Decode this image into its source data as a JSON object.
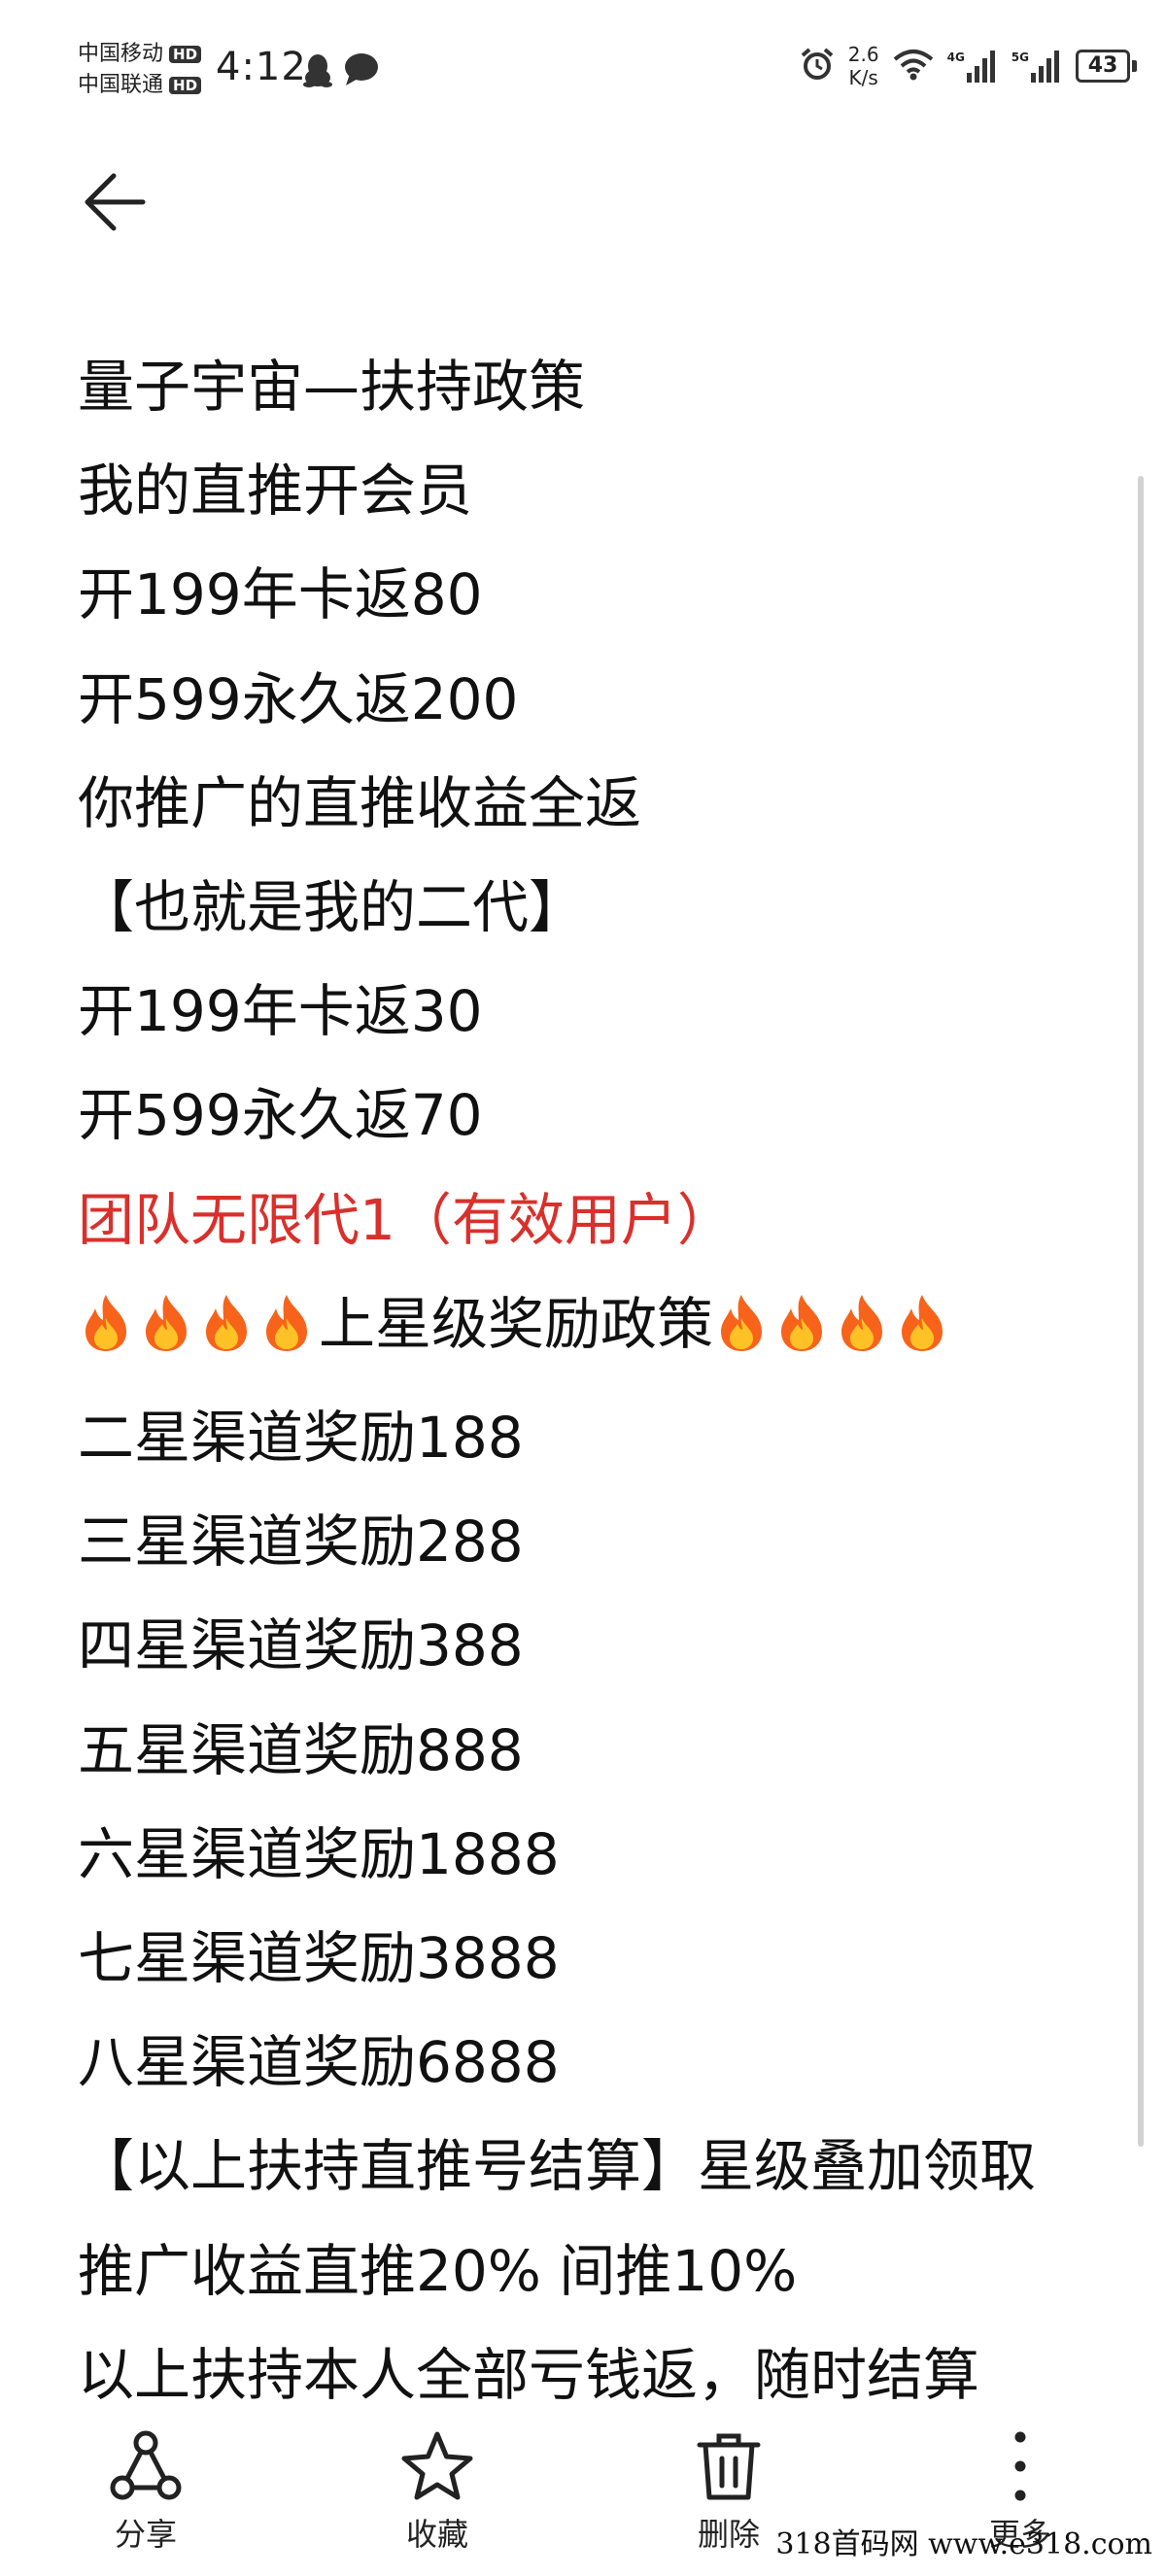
{
  "status_bar": {
    "carrier1": "中国移动",
    "carrier2": "中国联通",
    "hd_label": "HD",
    "time": "4:12",
    "net_speed_value": "2.6",
    "net_speed_unit": "K/s",
    "signal1_tag": "4G",
    "signal2_tag": "5G",
    "battery_level": "43",
    "icons": [
      "qq-penguin-icon",
      "chat-bubble-icon",
      "alarm-clock-icon",
      "wifi-icon",
      "signal-bars-icon",
      "battery-icon"
    ]
  },
  "header": {
    "back_icon": "arrow-left-icon"
  },
  "content": {
    "lines": [
      "量子宇宙—扶持政策",
      "我的直推开会员",
      "开199年卡返80",
      "开599永久返200",
      "你推广的直推收益全返",
      "【也就是我的二代】",
      "开199年卡返30",
      "开599永久返70",
      "团队无限代1（有效用户）",
      "",
      "二星渠道奖励188",
      "三星渠道奖励288",
      "四星渠道奖励388",
      "五星渠道奖励888",
      "六星渠道奖励1888",
      "七星渠道奖励3888",
      "八星渠道奖励6888",
      "【以上扶持直推号结算】星级叠加领取",
      "推广收益直推20%   间推10%",
      "以上扶持本人全部亏钱返，随时结算"
    ],
    "star_policy_title": "上星级奖励政策",
    "highlight_color": "#d9302c",
    "fire_emoji_icon": "fire-icon"
  },
  "toolbar": {
    "share": "分享",
    "favorite": "收藏",
    "delete": "删除",
    "more": "更多"
  },
  "watermark": "318首码网  www.e318.com"
}
